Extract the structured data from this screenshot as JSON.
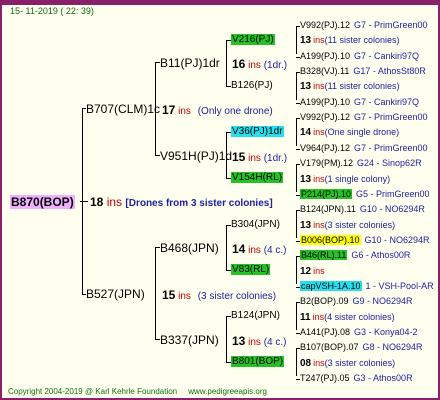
{
  "header": {
    "date": "15- 11-2019 ( 22: 39)"
  },
  "root": {
    "name": "B870(BOP)",
    "num": "18",
    "ins": "ins",
    "note": "[Drones from 3 sister colonies]"
  },
  "g1": [
    {
      "name": "B707(CLM)1c",
      "num": "17",
      "ins": "ins",
      "note": "(Only one drone)"
    },
    {
      "name": "B527(JPN)",
      "num": "15",
      "ins": "ins",
      "note": "(3 sister colonies)"
    }
  ],
  "g2": [
    {
      "name": "B11(PJ)1dr",
      "num": "16",
      "ins": "ins",
      "note": "(1dr.)"
    },
    {
      "name": "V951H(PJ)1d",
      "num": "15",
      "ins": "ins",
      "note": "(1dr.)"
    },
    {
      "name": "B468(JPN)",
      "num": "14",
      "ins": "ins",
      "note": "(4 c.)"
    },
    {
      "name": "B337(JPN)",
      "num": "13",
      "ins": "ins",
      "note": "(4 c.)"
    }
  ],
  "g3": [
    {
      "name": "V216(PJ)"
    },
    {
      "name": "B126(PJ)"
    },
    {
      "name": "V36(PJ)1dr"
    },
    {
      "name": "V154H(RL)"
    },
    {
      "name": "B304(JPN)"
    },
    {
      "name": "V83(RL)"
    },
    {
      "name": "B124(JPN)"
    },
    {
      "name": "B801(BOP)"
    }
  ],
  "g4": [
    {
      "name": "V992(PJ).12",
      "note": "G7 - PrimGreen00"
    },
    {
      "num": "13",
      "ins": "ins",
      "note": "(11 sister colonies)"
    },
    {
      "name": "A199(PJ).10",
      "note": "G7 - Cankiri97Q"
    },
    {
      "name": "B328(VJ).11",
      "note": "G17 - AthosSt80R"
    },
    {
      "num": "13",
      "ins": "ins",
      "note": "(11 sister colonies)"
    },
    {
      "name": "A199(PJ).10",
      "note": "G7 - Cankiri97Q"
    },
    {
      "name": "V992(PJ).12",
      "note": "G7 - PrimGreen00"
    },
    {
      "num": "14",
      "ins": "ins",
      "note": "(One single drone)"
    },
    {
      "name": "V964(PJ).12",
      "note": "G7 - PrimGreen00"
    },
    {
      "name": "V179(PM).12",
      "note": "G24 - Sinop62R"
    },
    {
      "num": "13",
      "ins": "ins",
      "note": "(1 single colony)"
    },
    {
      "name": "P214(PJ).10",
      "note": "G5 - PrimGreen00"
    },
    {
      "name": "B124(JPN).11",
      "note": "G10 - NO6294R"
    },
    {
      "num": "13",
      "ins": "ins",
      "note": "(3 sister colonies)"
    },
    {
      "name": "B006(BOP).10",
      "note": "G10 - NO6294R"
    },
    {
      "name": "B46(RL).11",
      "note": "G6 - Athos00R"
    },
    {
      "num": "12",
      "ins": "ins",
      "note": ""
    },
    {
      "name": "capVSH-1A.10",
      "note": "1 - VSH-Pool-AR"
    },
    {
      "name": "B2(BOP).09",
      "note": "G9 - NO6294R"
    },
    {
      "num": "11",
      "ins": "ins",
      "note": "(4 sister colonies)"
    },
    {
      "name": "A141(PJ).08",
      "note": "G3 - Konya04-2"
    },
    {
      "name": "B107(BOP).07",
      "note": "G8 - NO6294R"
    },
    {
      "num": "08",
      "ins": "ins",
      "note": "(3 sister colonies)"
    },
    {
      "name": "T247(PJ).05",
      "note": "G3 - Athos00R"
    }
  ],
  "footer": {
    "copyright": "Copyright 2004-2019 @ Karl Kehrle Foundation",
    "url": "www.pedigreeapis.org"
  },
  "colors": {
    "frame": "#8a1f6a",
    "ins": "#c00000",
    "note": "#2020a0",
    "green": "#22c322",
    "cyan": "#22e0f0",
    "yellow": "#ffff00",
    "pink": "#f0b0ff",
    "footer": "#107010"
  }
}
